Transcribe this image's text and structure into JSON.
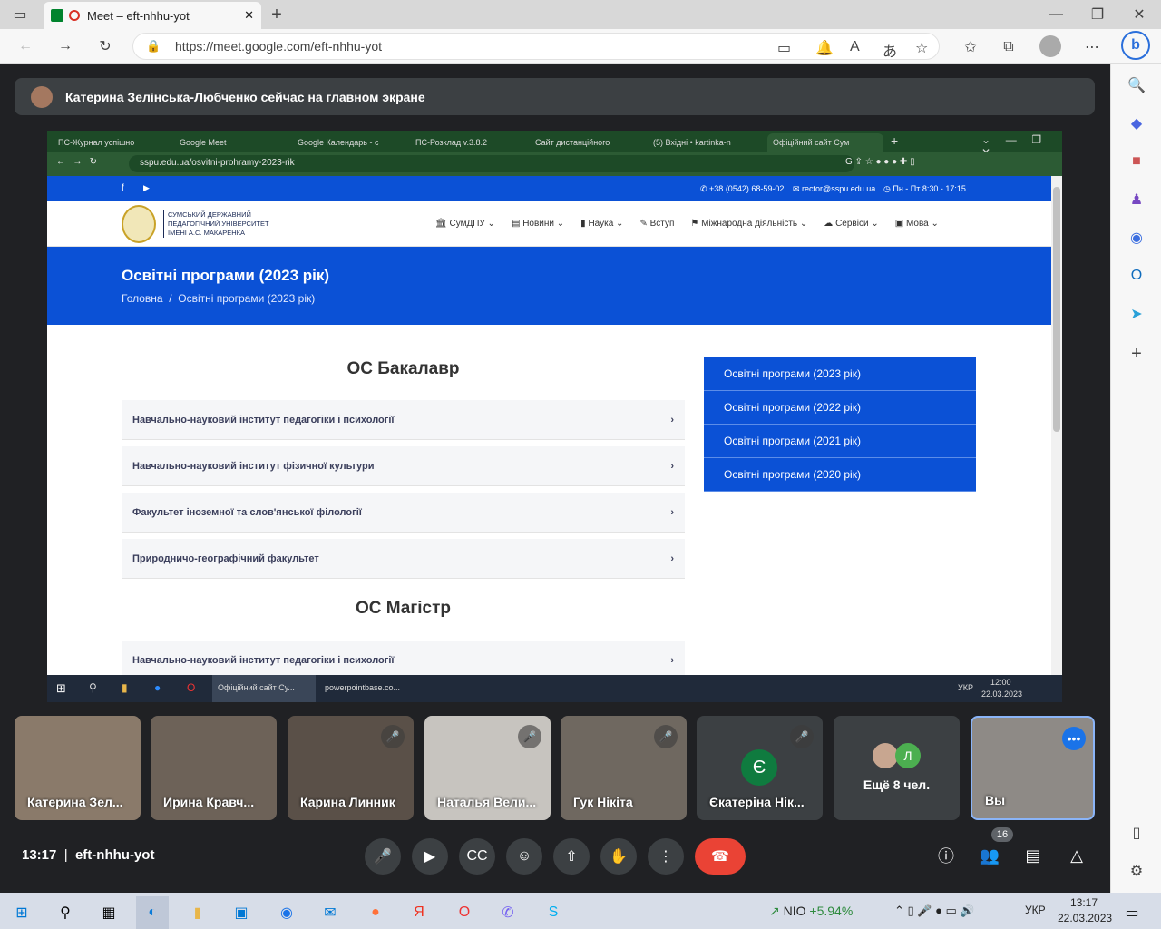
{
  "browser": {
    "tab_title": "Meet – eft-nhhu-yot",
    "url": "https://meet.google.com/eft-nhhu-yot"
  },
  "banner": {
    "text": "Катерина Зелінська-Любченко сейчас на главном экране"
  },
  "shared": {
    "tabs": [
      "ПС-Журнал успішно",
      "Google Meet",
      "Google Календарь - с",
      "ПС-Розклад v.3.8.2",
      "Сайт дистанційного",
      "(5) Вхідні • kartinka-n",
      "Офіційний сайт Сум"
    ],
    "url": "sspu.edu.ua/osvitni-prohramy-2023-rik",
    "topbar": {
      "phone": "+38 (0542) 68-59-02",
      "email": "rector@sspu.edu.ua",
      "hours": "Пн - Пт 8:30 - 17:15"
    },
    "logo_text": [
      "СУМСЬКИЙ ДЕРЖАВНИЙ",
      "ПЕДАГОГІЧНИЙ УНІВЕРСИТЕТ",
      "ІМЕНІ А.С. МАКАРЕНКА"
    ],
    "nav": [
      "СумДПУ",
      "Новини",
      "Наука",
      "Вступ",
      "Міжнародна діяльність",
      "Сервіси",
      "Мова"
    ],
    "hero": {
      "title": "Освітні програми (2023 рік)",
      "crumb_home": "Головна",
      "crumb_sep": "/",
      "crumb_current": "Освітні програми (2023 рік)"
    },
    "bachelor_title": "ОС Бакалавр",
    "bachelor_items": [
      "Навчально-науковий інститут педагогіки і психології",
      "Навчально-науковий інститут фізичної культури",
      "Факультет іноземної та слов'янської філології",
      "Природничо-географічний факультет"
    ],
    "master_title": "ОС Магістр",
    "master_items": [
      "Навчально-науковий інститут педагогіки і психології"
    ],
    "side_buttons": [
      "Освітні програми (2023 рік)",
      "Освітні програми (2022 рік)",
      "Освітні програми (2021 рік)",
      "Освітні програми (2020 рік)"
    ],
    "taskbar": {
      "app1": "Офіційний сайт Су...",
      "app2": "powerpointbase.co...",
      "lang": "УКР",
      "time": "12:00",
      "date": "22.03.2023"
    }
  },
  "participants": [
    {
      "name": "Катерина Зел...",
      "muted": false
    },
    {
      "name": "Ирина Кравч...",
      "muted": false
    },
    {
      "name": "Карина Линник",
      "muted": true
    },
    {
      "name": "Наталья Вели...",
      "muted": true
    },
    {
      "name": "Гук Нікіта",
      "muted": true
    },
    {
      "name": "Єкатеріна Нік...",
      "muted": true,
      "initial": "Є"
    },
    {
      "name": "Ещё 8 чел.",
      "initial": "Л"
    },
    {
      "name": "Вы"
    }
  ],
  "meeting": {
    "time": "13:17",
    "sep": "|",
    "code": "eft-nhhu-yot",
    "people_count": "16"
  },
  "taskbar": {
    "stock": "NIO",
    "stock_change": "+5.94%",
    "lang": "УКР",
    "time": "13:17",
    "date": "22.03.2023"
  },
  "colors": {
    "accent": "#0b51d6",
    "end_call": "#ea4335",
    "self_border": "#8ab4f8"
  }
}
